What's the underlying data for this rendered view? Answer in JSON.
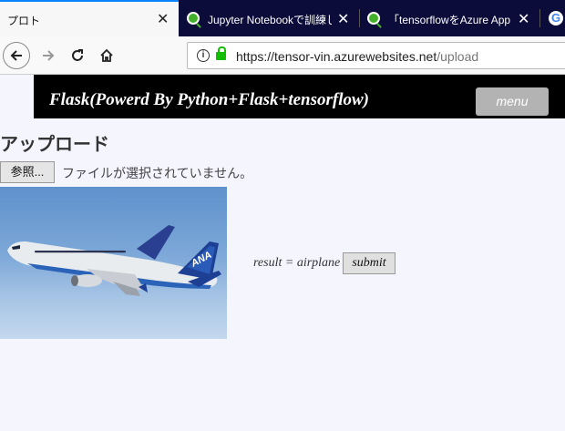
{
  "browser": {
    "tabs": [
      {
        "title": "プロト",
        "active": true
      },
      {
        "title": "Jupyter Notebookで訓練し"
      },
      {
        "title": "「tensorflowをAzure App S"
      },
      {
        "title": "G"
      }
    ],
    "url": {
      "host": "https://tensor-vin.azurewebsites.net",
      "path": "/upload"
    }
  },
  "header": {
    "title": "Flask(Powerd By Python+Flask+tensorflow)",
    "menu_label": "menu"
  },
  "page": {
    "heading": "アップロード",
    "file_button": "参照...",
    "file_status": "ファイルが選択されていません。",
    "result_text": "result = airplane",
    "submit_label": "submit",
    "photo_logo": "ANA"
  },
  "colors": {
    "tabbar": "#0c0c3a",
    "accent": "#0a84ff",
    "lock": "#12bc00",
    "header_bg": "#000000",
    "page_bg": "#f5f5fe"
  }
}
